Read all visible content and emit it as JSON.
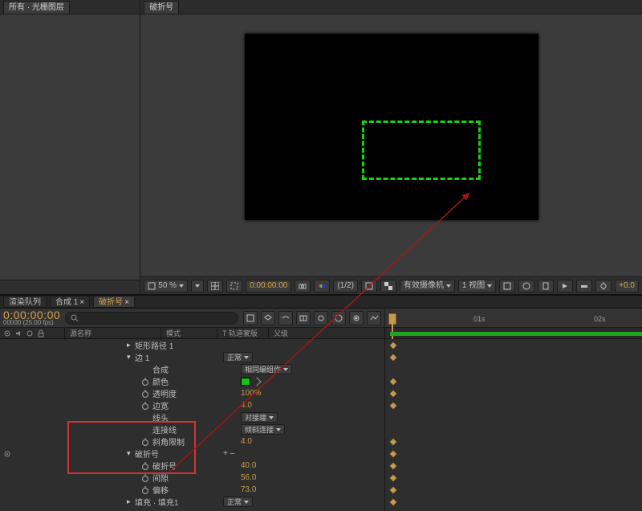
{
  "project": {
    "tab_label": "所有 · 光栅图层"
  },
  "preview": {
    "tab_label": "破折号"
  },
  "preview_footer": {
    "zoom": "50 %",
    "timecode": "0:00:00:00",
    "ratio": "(1/2)",
    "camera": "有效摄像机",
    "view": "1 视图",
    "exposure": "+0.0"
  },
  "timeline": {
    "tabs": [
      "渲染队列",
      "合成 1",
      "破折号"
    ],
    "active_tab_index": 2,
    "current_time": "0:00:00:00",
    "fps_label": "00000 (25.00 fps)",
    "ruler": {
      "t01": "01s",
      "t02": "02s"
    }
  },
  "columns": {
    "src": "源名称",
    "mode": "模式",
    "track": "T 轨道蒙版",
    "parent": "父级"
  },
  "props": {
    "shape_path": "矩形路径 1",
    "stroke1": "边 1",
    "stroke_mode": "正常",
    "composite": "合成",
    "composite_val": "相同编组作",
    "color": "颜色",
    "opacity": "透明度",
    "opacity_val": "100%",
    "stroke_w": "边宽",
    "stroke_w_val": "4.0",
    "line_cap": "线头",
    "line_cap_val": "对接端",
    "line_join": "连接线",
    "line_join_val": "倾斜连接",
    "miter": "斜角限制",
    "miter_val": "4.0",
    "dashes": "破折号",
    "dashes_btns": "+  –",
    "dash": "破折号",
    "dash_val": "40.0",
    "gap": "间隙",
    "gap_val": "56.0",
    "offset": "偏移",
    "offset_val": "73.0",
    "fill": "填充 · 填充1",
    "fill_mode": "正常"
  }
}
